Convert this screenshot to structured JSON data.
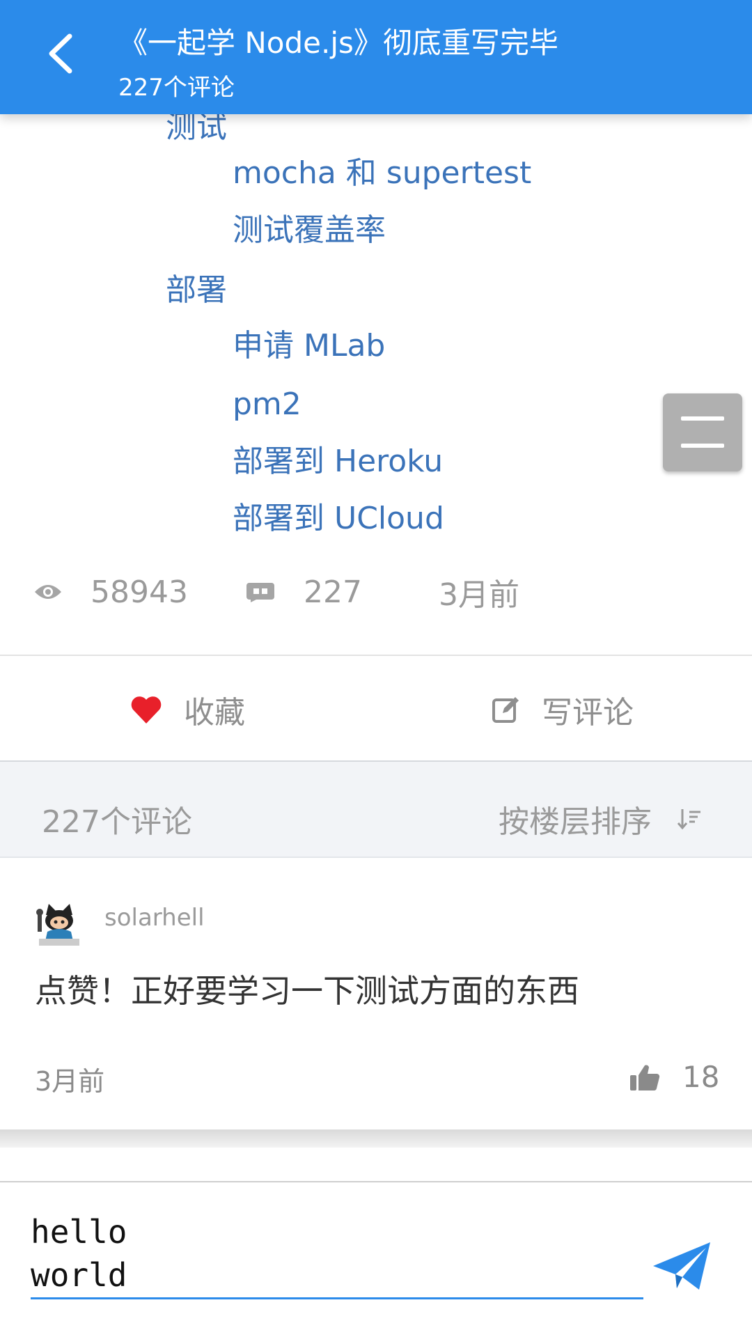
{
  "header": {
    "title": "《一起学 Node.js》彻底重写完毕",
    "subtitle": "227个评论"
  },
  "toc": {
    "items": [
      {
        "label": "测试",
        "level": 1
      },
      {
        "label": "mocha 和 supertest",
        "level": 2
      },
      {
        "label": "测试覆盖率",
        "level": 2
      },
      {
        "label": "部署",
        "level": 1
      },
      {
        "label": "申请 MLab",
        "level": 2
      },
      {
        "label": "pm2",
        "level": 2
      },
      {
        "label": "部署到 Heroku",
        "level": 2
      },
      {
        "label": "部署到 UCloud",
        "level": 2
      }
    ]
  },
  "stats": {
    "views": "58943",
    "comments": "227",
    "time": "3月前"
  },
  "actions": {
    "favorite_label": "收藏",
    "write_comment_label": "写评论"
  },
  "comments_header": {
    "count_label": "227个评论",
    "sort_label": "按楼层排序"
  },
  "comment": {
    "author": "solarhell",
    "text": "点赞！正好要学习一下测试方面的东西",
    "time": "3月前",
    "likes": "18"
  },
  "input": {
    "value": "hello\nworld"
  },
  "colors": {
    "primary": "#2b8bea",
    "link": "#3b73b9",
    "heart": "#e8202a"
  },
  "icons": [
    "back-arrow-icon",
    "menu-icon",
    "eye-icon",
    "comment-icon",
    "heart-icon",
    "edit-icon",
    "sort-icon",
    "thumbs-up-icon",
    "send-icon"
  ]
}
